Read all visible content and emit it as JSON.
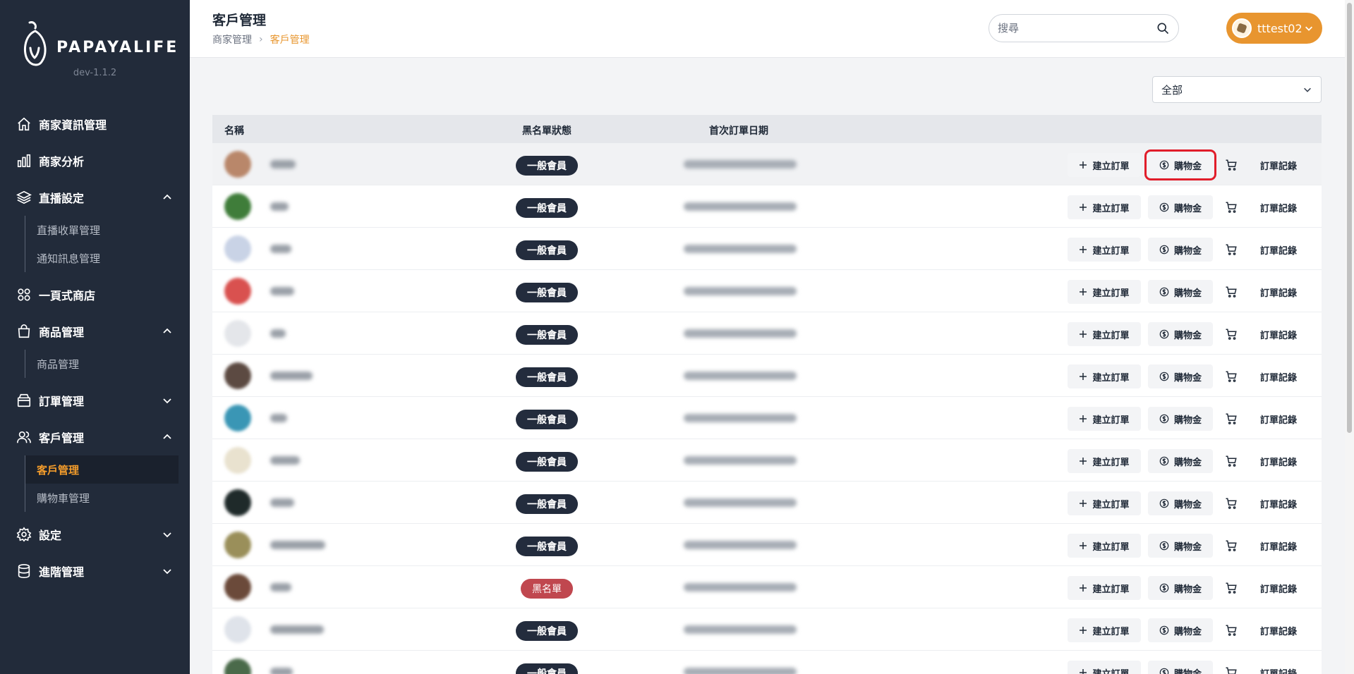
{
  "app": {
    "brand": "PAPAYALIFE",
    "version": "dev-1.1.2"
  },
  "sidebar": {
    "items": [
      {
        "label": "商家資訊管理",
        "icon": "home-icon"
      },
      {
        "label": "商家分析",
        "icon": "bar-chart-icon"
      },
      {
        "label": "直播設定",
        "icon": "layers-icon",
        "expanded": true,
        "children": [
          "直播收單管理",
          "通知訊息管理"
        ]
      },
      {
        "label": "一頁式商店",
        "icon": "grid-icon"
      },
      {
        "label": "商品管理",
        "icon": "bag-icon",
        "expanded": true,
        "children": [
          "商品管理"
        ]
      },
      {
        "label": "訂單管理",
        "icon": "box-icon",
        "expanded": false
      },
      {
        "label": "客戶管理",
        "icon": "users-icon",
        "expanded": true,
        "children": [
          "客戶管理",
          "購物車管理"
        ],
        "active_child": "客戶管理"
      },
      {
        "label": "設定",
        "icon": "gear-icon",
        "expanded": false
      },
      {
        "label": "進階管理",
        "icon": "database-icon",
        "expanded": false
      }
    ]
  },
  "header": {
    "title": "客戶管理",
    "breadcrumb": [
      "商家管理",
      "客戶管理"
    ],
    "search_placeholder": "搜尋",
    "username": "tttest02"
  },
  "filter": {
    "selected": "全部"
  },
  "table": {
    "columns": [
      "名稱",
      "黑名單狀態",
      "首次訂單日期"
    ],
    "actions": {
      "create_order": "建立訂單",
      "credit": "購物金",
      "records": "訂單記錄"
    },
    "rows": [
      {
        "status": "一般會員",
        "blacklisted": false
      },
      {
        "status": "一般會員",
        "blacklisted": false
      },
      {
        "status": "一般會員",
        "blacklisted": false
      },
      {
        "status": "一般會員",
        "blacklisted": false
      },
      {
        "status": "一般會員",
        "blacklisted": false
      },
      {
        "status": "一般會員",
        "blacklisted": false
      },
      {
        "status": "一般會員",
        "blacklisted": false
      },
      {
        "status": "一般會員",
        "blacklisted": false
      },
      {
        "status": "一般會員",
        "blacklisted": false
      },
      {
        "status": "一般會員",
        "blacklisted": false
      },
      {
        "status": "黑名單",
        "blacklisted": true
      },
      {
        "status": "一般會員",
        "blacklisted": false
      },
      {
        "status": "一般會員",
        "blacklisted": false
      }
    ]
  },
  "colors": {
    "sidebar_bg": "#222b3a",
    "accent": "#e8952f",
    "badge_normal": "#232c3d",
    "badge_blacklist": "#c0474f",
    "highlight": "#e11d2a"
  }
}
